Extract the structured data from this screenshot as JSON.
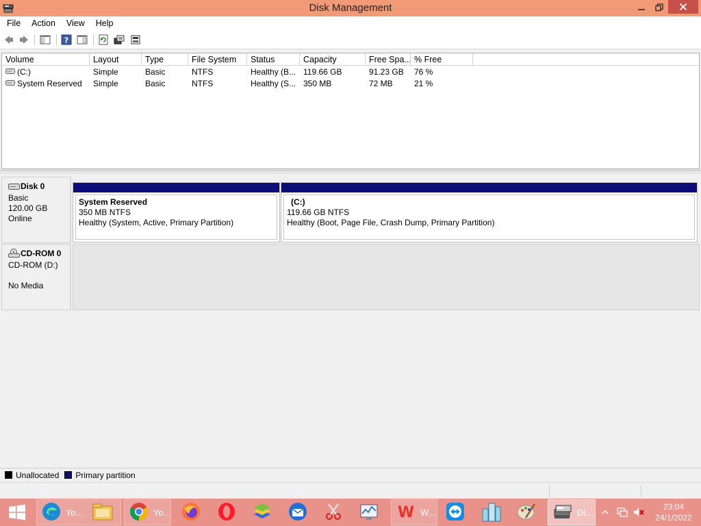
{
  "window": {
    "title": "Disk Management"
  },
  "menu": [
    "File",
    "Action",
    "View",
    "Help"
  ],
  "toolbar": {
    "buttons": [
      "back-icon",
      "forward-icon",
      "console-tree-icon",
      "help-icon",
      "properties-pane-icon",
      "refresh-icon",
      "rescan-disks-icon",
      "disk-properties-icon"
    ]
  },
  "volume_list": {
    "columns": [
      "Volume",
      "Layout",
      "Type",
      "File System",
      "Status",
      "Capacity",
      "Free Spa...",
      "% Free"
    ],
    "rows": [
      [
        "(C:)",
        "Simple",
        "Basic",
        "NTFS",
        "Healthy (B...",
        "119.66 GB",
        "91.23 GB",
        "76 %"
      ],
      [
        "System Reserved",
        "Simple",
        "Basic",
        "NTFS",
        "Healthy (S...",
        "350 MB",
        "72 MB",
        "21 %"
      ]
    ]
  },
  "disks": {
    "disk0": {
      "name": "Disk 0",
      "type": "Basic",
      "size": "120.00 GB",
      "state": "Online",
      "partitions": [
        {
          "name": "System Reserved",
          "size_fs": "350 MB NTFS",
          "status": "Healthy (System, Active, Primary Partition)"
        },
        {
          "name": "(C:)",
          "size_fs": "119.66 GB NTFS",
          "status": "Healthy (Boot, Page File, Crash Dump, Primary Partition)"
        }
      ]
    },
    "cdrom0": {
      "name": "CD-ROM 0",
      "drive": "CD-ROM (D:)",
      "media": "No Media"
    }
  },
  "legend": [
    {
      "label": "Unallocated",
      "color": "#000000"
    },
    {
      "label": "Primary partition",
      "color": "#0d0d7a"
    }
  ],
  "colors": {
    "titlebar": "#f19a75",
    "taskbar": "#e89289",
    "partition_bar": "#0d0d7a",
    "close_button": "#c7504b"
  },
  "taskbar": {
    "apps": [
      {
        "icon": "edge-icon",
        "label": "Yo..."
      },
      {
        "icon": "file-explorer-icon",
        "label": ""
      },
      {
        "icon": "chrome-icon",
        "label": "Yo..."
      },
      {
        "icon": "firefox-icon",
        "label": ""
      },
      {
        "icon": "opera-icon",
        "label": ""
      },
      {
        "icon": "bluestacks-icon",
        "label": ""
      },
      {
        "icon": "thunderbird-icon",
        "label": ""
      },
      {
        "icon": "snipping-tool-icon",
        "label": ""
      },
      {
        "icon": "performance-monitor-icon",
        "label": ""
      },
      {
        "icon": "wps-writer-icon",
        "label": "W..."
      },
      {
        "icon": "teamviewer-icon",
        "label": ""
      },
      {
        "icon": "building-app-icon",
        "label": ""
      },
      {
        "icon": "paint-icon",
        "label": ""
      },
      {
        "icon": "disk-management-icon",
        "label": "Di..."
      }
    ],
    "tray_icons": [
      "show-hidden-icons-icon",
      "network-icon",
      "volume-muted-icon"
    ],
    "time": "23:04",
    "date": "24/1/2022"
  }
}
